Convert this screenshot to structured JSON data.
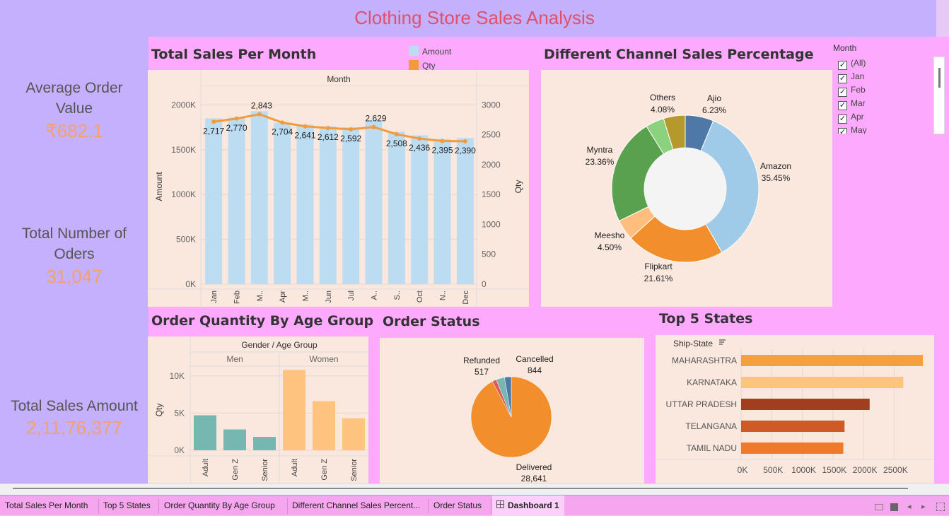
{
  "title": "Clothing Store Sales Analysis",
  "kpis": {
    "aov_label_1": "Average Order",
    "aov_label_2": "Value",
    "aov_value": "₹682.1",
    "orders_label_1": "Total Number of",
    "orders_label_2": "Oders",
    "orders_value": "31,047",
    "sales_label": "Total Sales Amount",
    "sales_value": "2,11,76,377"
  },
  "sections": {
    "sales_per_month": "Total Sales Per Month",
    "channel": "Different Channel Sales Percentage",
    "age_group": "Order Quantity By Age Group",
    "order_status": "Order Status",
    "top_states": "Top 5 States"
  },
  "legend": {
    "amount": "Amount",
    "qty": "Qty",
    "amount_color": "#bcdcf2",
    "qty_color": "#f59a3b"
  },
  "month_filter": {
    "title": "Month",
    "items": [
      "(All)",
      "Jan",
      "Feb",
      "Mar",
      "Apr",
      "May"
    ]
  },
  "tabs": [
    "Total Sales Per Month",
    "Top 5 States",
    "Order Quantity By Age Group",
    "Different Channel Sales Percent...",
    "Order Status",
    "Dashboard 1"
  ],
  "chart_data": [
    {
      "type": "bar",
      "title": "Total Sales Per Month",
      "header": "Month",
      "categories": [
        "Jan",
        "Feb",
        "M..",
        "Apr",
        "M..",
        "Jun",
        "Jul",
        "A..",
        "S..",
        "Oct",
        "N..",
        "Dec"
      ],
      "series": [
        {
          "name": "Amount",
          "axis": "left",
          "values": [
            1850000,
            1860000,
            1930000,
            1800000,
            1780000,
            1760000,
            1750000,
            1830000,
            1700000,
            1660000,
            1620000,
            1630000
          ]
        },
        {
          "name": "Qty",
          "axis": "right",
          "type": "line",
          "values": [
            2717,
            2770,
            2843,
            2704,
            2641,
            2612,
            2592,
            2629,
            2508,
            2436,
            2395,
            2390
          ],
          "labels": [
            "2,717",
            "2,770",
            "2,843",
            "2,704",
            "2,641",
            "2,612",
            "2,592",
            "2,629",
            "2,508",
            "2,436",
            "2,395",
            "2,390"
          ]
        }
      ],
      "ylabel": "Amount",
      "y2label": "Qty",
      "ylim": [
        0,
        2200000
      ],
      "y2lim": [
        0,
        3300
      ],
      "yticks": [
        "0K",
        "500K",
        "1000K",
        "1500K",
        "2000K"
      ],
      "y2ticks": [
        "0",
        "500",
        "1000",
        "1500",
        "2000",
        "2500",
        "3000"
      ]
    },
    {
      "type": "pie",
      "title": "Different Channel Sales Percentage",
      "slices": [
        {
          "name": "Ajio",
          "label": "6.23%",
          "value": 6.23,
          "color": "#4e79a7"
        },
        {
          "name": "Amazon",
          "label": "35.45%",
          "value": 35.45,
          "color": "#a0cbe8"
        },
        {
          "name": "Flipkart",
          "label": "21.61%",
          "value": 21.61,
          "color": "#f28e2b"
        },
        {
          "name": "Meesho",
          "label": "4.50%",
          "value": 4.5,
          "color": "#ffbe7d"
        },
        {
          "name": "Myntra",
          "label": "23.36%",
          "value": 23.36,
          "color": "#59a14f"
        },
        {
          "name": "Others",
          "label": "4.08%",
          "value": 4.08,
          "color": "#8cd17d"
        },
        {
          "name": "",
          "label": "",
          "value": 4.77,
          "color": "#b6992d"
        }
      ]
    },
    {
      "type": "bar",
      "title": "Order Quantity By Age Group",
      "header": "Gender / Age Group",
      "groups": [
        "Men",
        "Women"
      ],
      "categories": [
        "Adult",
        "Gen Z",
        "Senior"
      ],
      "series": [
        {
          "group": "Men",
          "values": [
            4700,
            2800,
            1800
          ],
          "color": "#76b7b2"
        },
        {
          "group": "Women",
          "values": [
            10800,
            6600,
            4300
          ],
          "color": "#ffc380"
        }
      ],
      "ylabel": "Qty",
      "ylim": [
        0,
        11500
      ],
      "yticks": [
        "0K",
        "5K",
        "10K"
      ]
    },
    {
      "type": "pie",
      "title": "Order Status",
      "slices": [
        {
          "name": "Delivered",
          "label": "28,641",
          "value": 28641,
          "color": "#f28e2b"
        },
        {
          "name": "Refunded",
          "label": "517",
          "value": 517,
          "color": "#e15759"
        },
        {
          "name": "",
          "label": "",
          "value": 1045,
          "color": "#76b7b2"
        },
        {
          "name": "Cancelled",
          "label": "844",
          "value": 844,
          "color": "#4e79a7"
        }
      ]
    },
    {
      "type": "bar",
      "orientation": "horizontal",
      "title": "Top 5 States",
      "header": "Ship-State",
      "categories": [
        "MAHARASHTRA",
        "KARNATAKA",
        "UTTAR PRADESH",
        "TELANGANA",
        "TAMIL NADU"
      ],
      "values": [
        2970000,
        2650000,
        2100000,
        1690000,
        1670000
      ],
      "colors": [
        "#f5a03c",
        "#fbc57e",
        "#a23d20",
        "#cf5a28",
        "#f07a2a"
      ],
      "xticks": [
        "0K",
        "500K",
        "1000K",
        "1500K",
        "2000K",
        "2500K"
      ],
      "xlim": [
        0,
        3050000
      ]
    }
  ]
}
